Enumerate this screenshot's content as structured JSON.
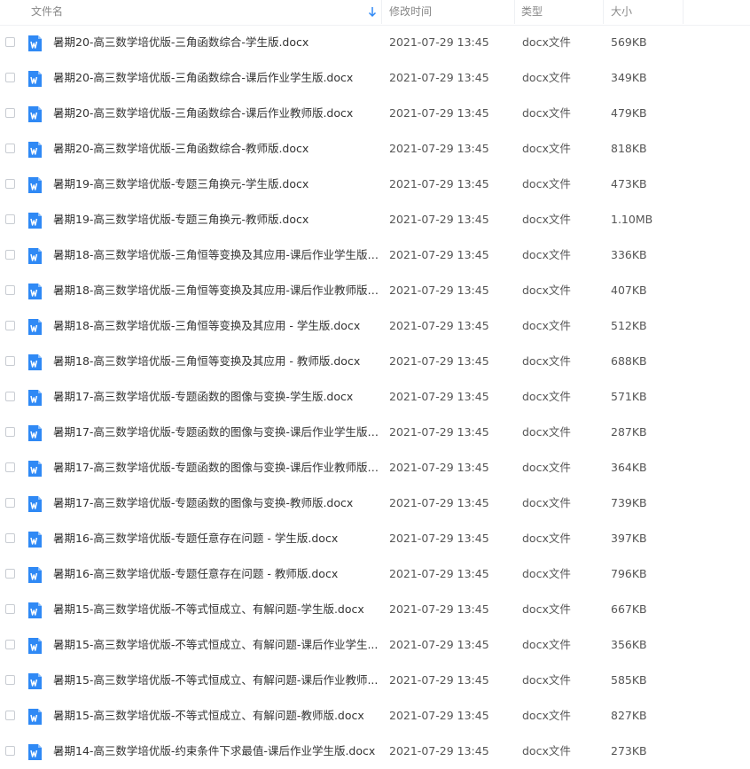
{
  "columns": {
    "name": "文件名",
    "modified": "修改时间",
    "type": "类型",
    "size": "大小"
  },
  "sort_icon": "arrow-down-icon",
  "file_icon": "word-doc-icon",
  "accent_color": "#2f89f5",
  "files": [
    {
      "name": "暑期20-高三数学培优版-三角函数综合-学生版.docx",
      "modified": "2021-07-29 13:45",
      "type": "docx文件",
      "size": "569KB"
    },
    {
      "name": "暑期20-高三数学培优版-三角函数综合-课后作业学生版.docx",
      "modified": "2021-07-29 13:45",
      "type": "docx文件",
      "size": "349KB"
    },
    {
      "name": "暑期20-高三数学培优版-三角函数综合-课后作业教师版.docx",
      "modified": "2021-07-29 13:45",
      "type": "docx文件",
      "size": "479KB"
    },
    {
      "name": "暑期20-高三数学培优版-三角函数综合-教师版.docx",
      "modified": "2021-07-29 13:45",
      "type": "docx文件",
      "size": "818KB"
    },
    {
      "name": "暑期19-高三数学培优版-专题三角换元-学生版.docx",
      "modified": "2021-07-29 13:45",
      "type": "docx文件",
      "size": "473KB"
    },
    {
      "name": "暑期19-高三数学培优版-专题三角换元-教师版.docx",
      "modified": "2021-07-29 13:45",
      "type": "docx文件",
      "size": "1.10MB"
    },
    {
      "name": "暑期18-高三数学培优版-三角恒等变换及其应用-课后作业学生版.d...",
      "modified": "2021-07-29 13:45",
      "type": "docx文件",
      "size": "336KB"
    },
    {
      "name": "暑期18-高三数学培优版-三角恒等变换及其应用-课后作业教师版.d...",
      "modified": "2021-07-29 13:45",
      "type": "docx文件",
      "size": "407KB"
    },
    {
      "name": "暑期18-高三数学培优版-三角恒等变换及其应用 - 学生版.docx",
      "modified": "2021-07-29 13:45",
      "type": "docx文件",
      "size": "512KB"
    },
    {
      "name": "暑期18-高三数学培优版-三角恒等变换及其应用 - 教师版.docx",
      "modified": "2021-07-29 13:45",
      "type": "docx文件",
      "size": "688KB"
    },
    {
      "name": "暑期17-高三数学培优版-专题函数的图像与变换-学生版.docx",
      "modified": "2021-07-29 13:45",
      "type": "docx文件",
      "size": "571KB"
    },
    {
      "name": "暑期17-高三数学培优版-专题函数的图像与变换-课后作业学生版.d...",
      "modified": "2021-07-29 13:45",
      "type": "docx文件",
      "size": "287KB"
    },
    {
      "name": "暑期17-高三数学培优版-专题函数的图像与变换-课后作业教师版.d...",
      "modified": "2021-07-29 13:45",
      "type": "docx文件",
      "size": "364KB"
    },
    {
      "name": "暑期17-高三数学培优版-专题函数的图像与变换-教师版.docx",
      "modified": "2021-07-29 13:45",
      "type": "docx文件",
      "size": "739KB"
    },
    {
      "name": "暑期16-高三数学培优版-专题任意存在问题 - 学生版.docx",
      "modified": "2021-07-29 13:45",
      "type": "docx文件",
      "size": "397KB"
    },
    {
      "name": "暑期16-高三数学培优版-专题任意存在问题 - 教师版.docx",
      "modified": "2021-07-29 13:45",
      "type": "docx文件",
      "size": "796KB"
    },
    {
      "name": "暑期15-高三数学培优版-不等式恒成立、有解问题-学生版.docx",
      "modified": "2021-07-29 13:45",
      "type": "docx文件",
      "size": "667KB"
    },
    {
      "name": "暑期15-高三数学培优版-不等式恒成立、有解问题-课后作业学生...",
      "modified": "2021-07-29 13:45",
      "type": "docx文件",
      "size": "356KB"
    },
    {
      "name": "暑期15-高三数学培优版-不等式恒成立、有解问题-课后作业教师...",
      "modified": "2021-07-29 13:45",
      "type": "docx文件",
      "size": "585KB"
    },
    {
      "name": "暑期15-高三数学培优版-不等式恒成立、有解问题-教师版.docx",
      "modified": "2021-07-29 13:45",
      "type": "docx文件",
      "size": "827KB"
    },
    {
      "name": "暑期14-高三数学培优版-约束条件下求最值-课后作业学生版.docx",
      "modified": "2021-07-29 13:45",
      "type": "docx文件",
      "size": "273KB"
    }
  ]
}
